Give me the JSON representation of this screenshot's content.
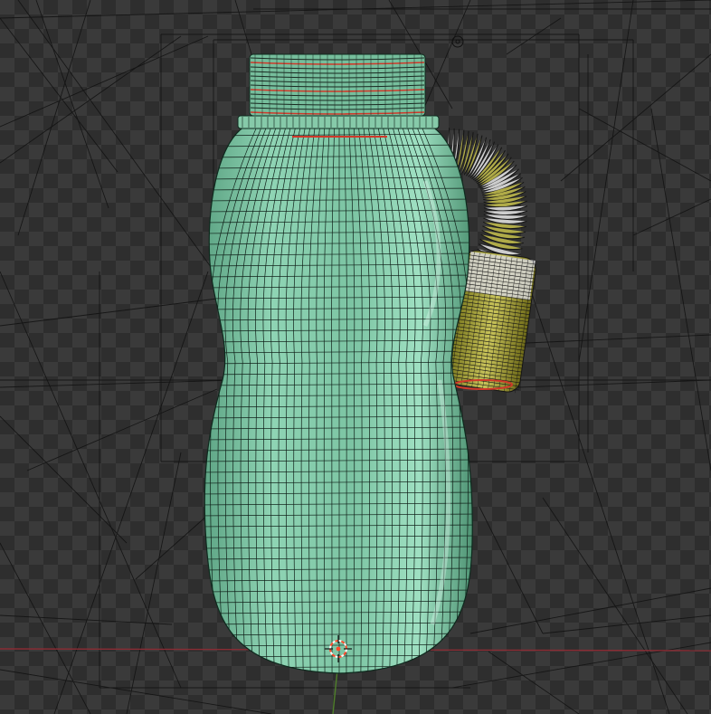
{
  "viewport": {
    "kind": "3D viewport, wireframe overlay on shaded mesh",
    "objects": [
      "bottle",
      "bottle-cap-threads",
      "flexible-hose"
    ],
    "colors": {
      "background_light": "#3a3a3a",
      "background_dark": "#2e2e2e",
      "bottle_body": "#7fc7a6",
      "wire": "#1a1a1a",
      "hose_green": "#a8a23a",
      "hose_white": "#d8d8d8",
      "edge_red": "#d0392a",
      "x_axis": "#8a2c34",
      "y_axis": "#4f7f2a",
      "cursor": "#ff4b2b"
    }
  }
}
